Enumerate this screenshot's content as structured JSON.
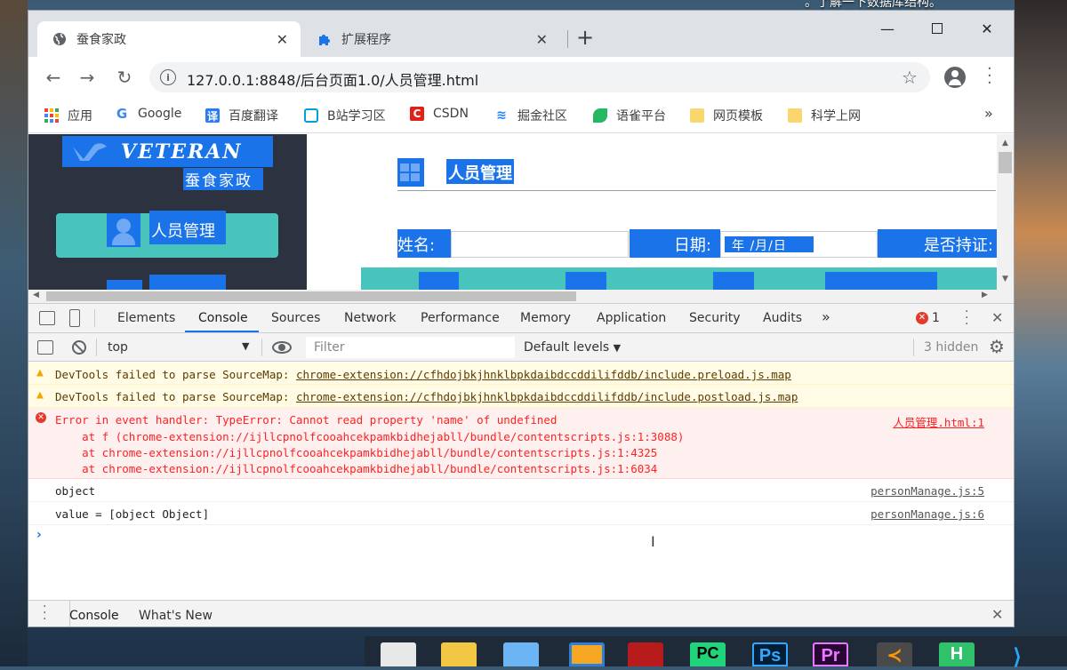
{
  "desktop": {
    "overlay_text": "。了解一下数据库结构。"
  },
  "tabs": [
    {
      "title": "蚕食家政",
      "icon": "globe-icon"
    },
    {
      "title": "扩展程序",
      "icon": "puzzle-icon"
    }
  ],
  "address_bar": {
    "url": "127.0.0.1:8848/后台页面1.0/人员管理.html"
  },
  "bookmarks": [
    {
      "label": "应用",
      "icon": "apps-grid-icon"
    },
    {
      "label": "Google",
      "icon": "google-icon"
    },
    {
      "label": "百度翻译",
      "icon": "baidu-translate-icon"
    },
    {
      "label": "B站学习区",
      "icon": "bilibili-icon"
    },
    {
      "label": "CSDN",
      "icon": "csdn-icon"
    },
    {
      "label": "掘金社区",
      "icon": "juejin-icon"
    },
    {
      "label": "语雀平台",
      "icon": "yuque-icon"
    },
    {
      "label": "网页模板",
      "icon": "folder-icon"
    },
    {
      "label": "科学上网",
      "icon": "folder-icon"
    }
  ],
  "page": {
    "logo_text": "VETERAN",
    "brand": "蚕食家政",
    "nav_active": "人员管理",
    "title": "人员管理",
    "form": {
      "name_label": "姓名:",
      "date_label": "日期:",
      "date_placeholder": "年 /月/日",
      "cert_label": "是否持证:"
    }
  },
  "devtools": {
    "tabs": [
      "Elements",
      "Console",
      "Sources",
      "Network",
      "Performance",
      "Memory",
      "Application",
      "Security",
      "Audits"
    ],
    "active_tab": "Console",
    "error_count": "1",
    "context": "top",
    "filter_placeholder": "Filter",
    "levels": "Default levels",
    "hidden": "3 hidden",
    "messages": [
      {
        "type": "warning",
        "text": "DevTools failed to parse SourceMap: ",
        "link": "chrome-extension://cfhdojbkjhnklbpkdaibdccddilifddb/include.preload.js.map"
      },
      {
        "type": "warning",
        "text": "DevTools failed to parse SourceMap: ",
        "link": "chrome-extension://cfhdojbkjhnklbpkdaibdccddilifddb/include.postload.js.map"
      },
      {
        "type": "error",
        "text": "Error in event handler: TypeError: Cannot read property 'name' of undefined",
        "source": "人员管理.html:1",
        "stack": [
          "    at f (chrome-extension://ijllcpnolfcooahcekpamkbidhejabll/bundle/contentscripts.js:1:3088)",
          "    at chrome-extension://ijllcpnolfcooahcekpamkbidhejabll/bundle/contentscripts.js:1:4325",
          "    at chrome-extension://ijllcpnolfcooahcekpamkbidhejabll/bundle/contentscripts.js:1:6034"
        ]
      },
      {
        "type": "log",
        "text": "object",
        "source": "personManage.js:5"
      },
      {
        "type": "log",
        "text": "value = [object Object]",
        "source": "personManage.js:6"
      }
    ],
    "drawer_tabs": [
      "Console",
      "What's New"
    ]
  },
  "taskbar_apps": [
    "recycle-bin-icon",
    "files-icon",
    "folder-icon",
    "explorer-icon",
    "winrar-icon",
    "pycharm-icon",
    "photoshop-icon",
    "premiere-icon",
    "sublime-icon",
    "hbuilder-icon",
    "vscode-icon"
  ]
}
